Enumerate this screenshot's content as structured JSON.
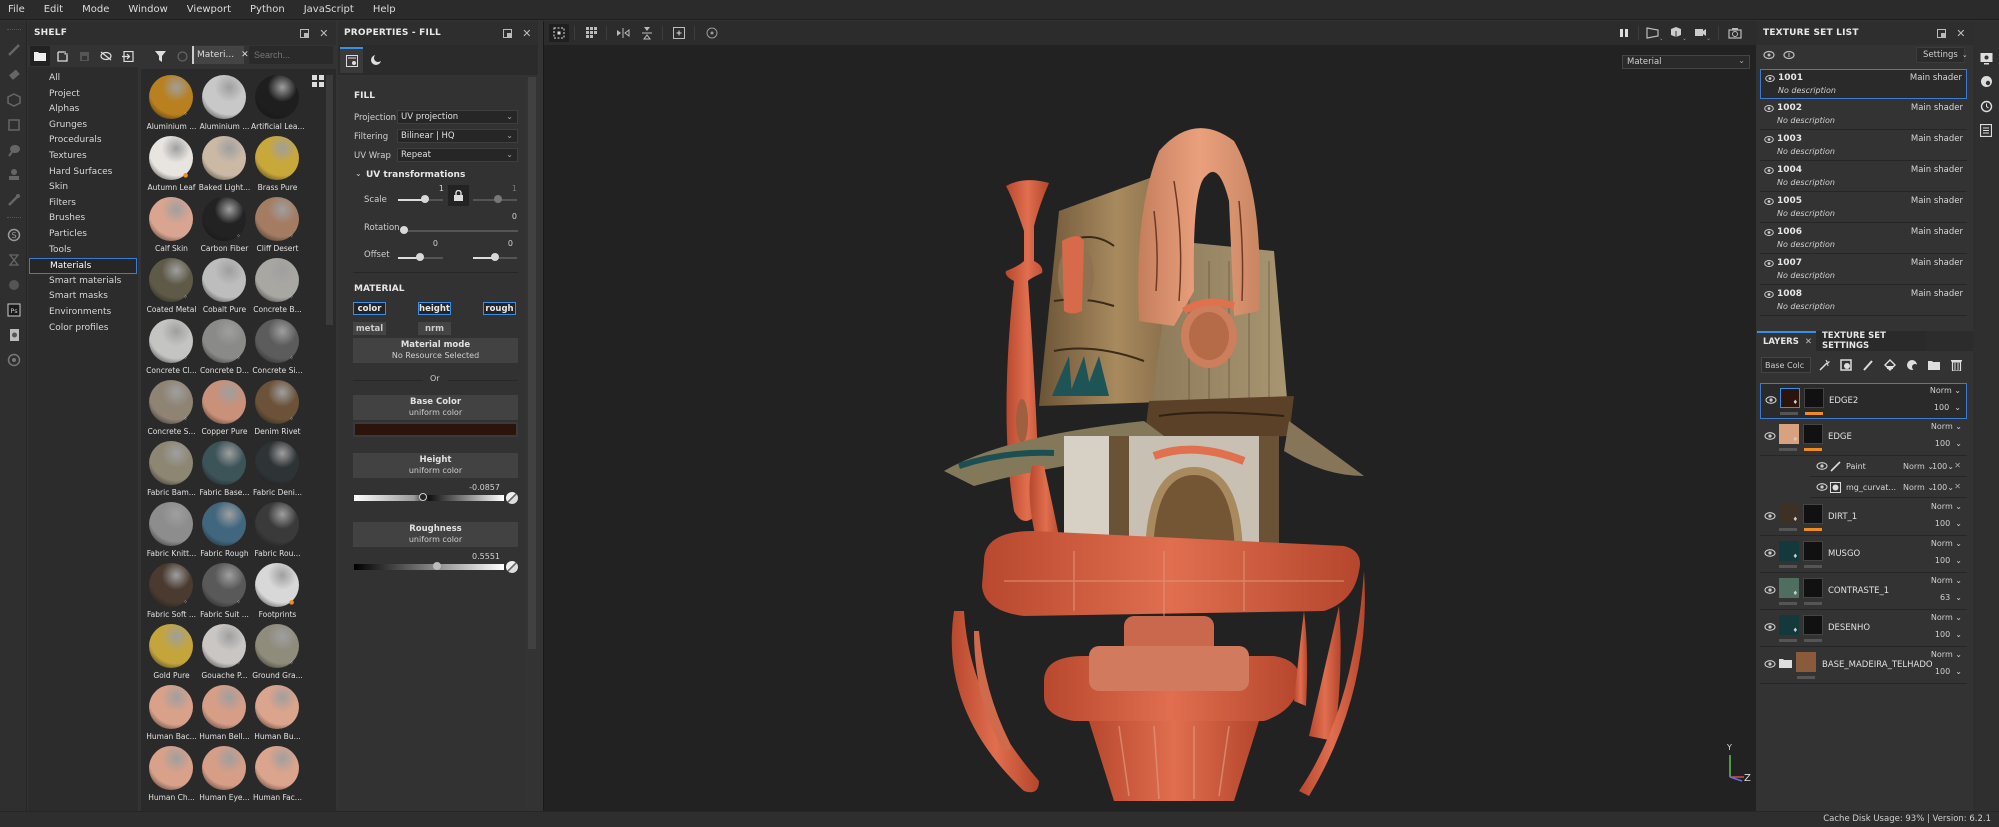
{
  "menu": [
    "File",
    "Edit",
    "Mode",
    "Window",
    "Viewport",
    "Python",
    "JavaScript",
    "Help"
  ],
  "tools": [
    "paint-brush",
    "eraser",
    "projection",
    "polygon-fill",
    "smudge",
    "clone",
    "color-picker",
    "bake-mesh",
    "hourglass",
    "substance",
    "photoshop-export",
    "document",
    "settings"
  ],
  "shelf": {
    "title": "SHELF",
    "filter_chip": "Materi...",
    "search_placeholder": "Search...",
    "categories": [
      "All",
      "Project",
      "Alphas",
      "Grunges",
      "Procedurals",
      "Textures",
      "Hard Surfaces",
      "Skin",
      "Filters",
      "Brushes",
      "Particles",
      "Tools",
      "Materials",
      "Smart materials",
      "Smart masks",
      "Environments",
      "Color profiles"
    ],
    "active_category": "Materials",
    "materials": [
      {
        "name": "Aluminium ...",
        "color": "#b8801f",
        "badge": "grey"
      },
      {
        "name": "Aluminium ...",
        "color": "#c8c8c8",
        "badge": "none"
      },
      {
        "name": "Artificial Lea...",
        "color": "#1e1e1e",
        "badge": "none"
      },
      {
        "name": "Autumn Leaf",
        "color": "#e8e4e0",
        "badge": "orange"
      },
      {
        "name": "Baked Light...",
        "color": "#cbb9a6",
        "badge": "none"
      },
      {
        "name": "Brass Pure",
        "color": "#c9a83a",
        "badge": "none"
      },
      {
        "name": "Calf Skin",
        "color": "#d9a590",
        "badge": "none"
      },
      {
        "name": "Carbon Fiber",
        "color": "#222222",
        "badge": "grey"
      },
      {
        "name": "Cliff Desert",
        "color": "#a47c62",
        "badge": "grey"
      },
      {
        "name": "Coated Metal",
        "color": "#5f5a48",
        "badge": "grey"
      },
      {
        "name": "Cobalt Pure",
        "color": "#bdbdbd",
        "badge": "none"
      },
      {
        "name": "Concrete B...",
        "color": "#a9a7a2",
        "badge": "grey"
      },
      {
        "name": "Concrete Cl...",
        "color": "#c4c4c2",
        "badge": "grey"
      },
      {
        "name": "Concrete D...",
        "color": "#8a8a88",
        "badge": "grey"
      },
      {
        "name": "Concrete Si...",
        "color": "#5c5c5c",
        "badge": "grey"
      },
      {
        "name": "Concrete S...",
        "color": "#8f8374",
        "badge": "grey"
      },
      {
        "name": "Copper Pure",
        "color": "#c9917a",
        "badge": "none"
      },
      {
        "name": "Denim Rivet",
        "color": "#6b5238",
        "badge": "grey"
      },
      {
        "name": "Fabric Bam...",
        "color": "#8d8672",
        "badge": "none"
      },
      {
        "name": "Fabric Base...",
        "color": "#3c5358",
        "badge": "none"
      },
      {
        "name": "Fabric Deni...",
        "color": "#2e3336",
        "badge": "none"
      },
      {
        "name": "Fabric Knitt...",
        "color": "#8d8d8d",
        "badge": "none"
      },
      {
        "name": "Fabric Rough",
        "color": "#41677f",
        "badge": "none"
      },
      {
        "name": "Fabric Rou...",
        "color": "#3a3a3a",
        "badge": "none"
      },
      {
        "name": "Fabric Soft ...",
        "color": "#4a3a30",
        "badge": "grey"
      },
      {
        "name": "Fabric Suit ...",
        "color": "#595959",
        "badge": "grey"
      },
      {
        "name": "Footprints",
        "color": "#d8d8d8",
        "badge": "orange"
      },
      {
        "name": "Gold Pure",
        "color": "#c4a53c",
        "badge": "none"
      },
      {
        "name": "Gouache P...",
        "color": "#c9c6c4",
        "badge": "grey"
      },
      {
        "name": "Ground Gra...",
        "color": "#8f8c7c",
        "badge": "grey"
      },
      {
        "name": "Human Bac...",
        "color": "#d9a18a",
        "badge": "none"
      },
      {
        "name": "Human Bell...",
        "color": "#d69e87",
        "badge": "none"
      },
      {
        "name": "Human Bu...",
        "color": "#dba48c",
        "badge": "none"
      },
      {
        "name": "Human Ch...",
        "color": "#d9a18a",
        "badge": "none"
      },
      {
        "name": "Human Eye...",
        "color": "#d69e87",
        "badge": "none"
      },
      {
        "name": "Human Fac...",
        "color": "#dba48c",
        "badge": "none"
      }
    ]
  },
  "properties": {
    "title": "PROPERTIES - FILL",
    "fill_heading": "FILL",
    "projection_label": "Projection",
    "projection_value": "UV projection",
    "filtering_label": "Filtering",
    "filtering_value": "Bilinear | HQ",
    "uvwrap_label": "UV Wrap",
    "uvwrap_value": "Repeat",
    "uv_transform_heading": "UV transformations",
    "scale_label": "Scale",
    "scale_value_u": "1",
    "scale_value_v": "1",
    "rotation_label": "Rotation",
    "rotation_value": "0",
    "offset_label": "Offset",
    "offset_value_u": "0",
    "offset_value_v": "0",
    "material_heading": "MATERIAL",
    "channels": [
      {
        "label": "color",
        "on": true
      },
      {
        "label": "height",
        "on": true
      },
      {
        "label": "rough",
        "on": true
      },
      {
        "label": "metal",
        "on": false
      },
      {
        "label": "nrm",
        "on": false
      }
    ],
    "material_mode_title": "Material mode",
    "material_mode_sub": "No Resource Selected",
    "or_label": "Or",
    "base_color_title": "Base Color",
    "base_color_sub": "uniform color",
    "base_color_value": "#2a140b",
    "height_title": "Height",
    "height_sub": "uniform color",
    "height_value": "-0.0857",
    "height_fraction": 0.457,
    "roughness_title": "Roughness",
    "roughness_sub": "uniform color",
    "roughness_value": "0.5551",
    "roughness_fraction": 0.5551
  },
  "viewport": {
    "mode_value": "Material",
    "axis_y": "Y",
    "axis_z": "Z"
  },
  "texture_sets": {
    "title": "TEXTURE SET LIST",
    "settings_label": "Settings",
    "items": [
      {
        "name": "1001",
        "shader": "Main shader",
        "desc": "No description",
        "active": true
      },
      {
        "name": "1002",
        "shader": "Main shader",
        "desc": "No description",
        "active": false
      },
      {
        "name": "1003",
        "shader": "Main shader",
        "desc": "No description",
        "active": false
      },
      {
        "name": "1004",
        "shader": "Main shader",
        "desc": "No description",
        "active": false
      },
      {
        "name": "1005",
        "shader": "Main shader",
        "desc": "No description",
        "active": false
      },
      {
        "name": "1006",
        "shader": "Main shader",
        "desc": "No description",
        "active": false
      },
      {
        "name": "1007",
        "shader": "Main shader",
        "desc": "No description",
        "active": false
      },
      {
        "name": "1008",
        "shader": "Main shader",
        "desc": "No description",
        "active": false
      }
    ]
  },
  "layers": {
    "tab_layers": "LAYERS",
    "tab_tss": "TEXTURE SET SETTINGS",
    "channel_select": "Base Colc",
    "items": [
      {
        "name": "EDGE2",
        "blend": "Norm",
        "opacity": "100",
        "swatch": "#2a140b",
        "active": true,
        "mask_bar": "orange"
      },
      {
        "name": "EDGE",
        "blend": "Norm",
        "opacity": "100",
        "swatch": "#d9a27e",
        "active": false,
        "mask_bar": "orange"
      },
      {
        "name": "DIRT_1",
        "blend": "Norm",
        "opacity": "100",
        "swatch": "#3d3125",
        "active": false,
        "mask_bar": "orange"
      },
      {
        "name": "MUSGO",
        "blend": "Norm",
        "opacity": "100",
        "swatch": "#14393c",
        "active": false,
        "mask_bar": "grey"
      },
      {
        "name": "CONTRASTE_1",
        "blend": "Norm",
        "opacity": "63",
        "swatch": "#4f6e5f",
        "active": false,
        "mask_bar": "grey"
      },
      {
        "name": "DESENHO",
        "blend": "Norm",
        "opacity": "100",
        "swatch": "#14393c",
        "active": false,
        "mask_bar": "grey"
      },
      {
        "name": "BASE_MADEIRA_TELHADO",
        "blend": "Norm",
        "opacity": "100",
        "swatch": "#8a5a3c",
        "active": false,
        "folder": true
      }
    ],
    "sublayers": [
      {
        "name": "Paint",
        "blend": "Norm",
        "opacity": "100"
      },
      {
        "name": "mg_curvat...",
        "blend": "Norm",
        "opacity": "100"
      }
    ]
  },
  "status": {
    "text": "Cache Disk Usage:   93% | Version: 6.2.1"
  },
  "colors": {
    "accent": "#3a8ee6",
    "orange": "#f08a24"
  }
}
